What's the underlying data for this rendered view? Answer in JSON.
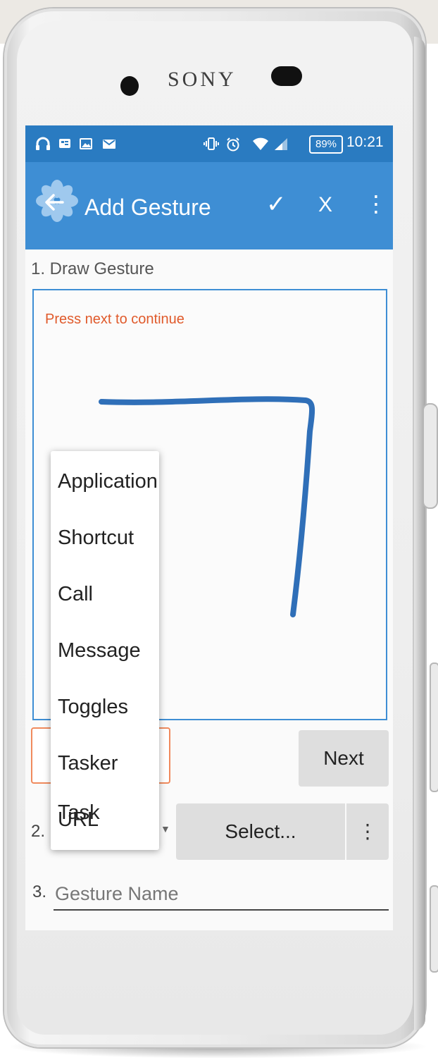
{
  "device": {
    "brand": "SONY"
  },
  "status_bar": {
    "battery": "89%",
    "time": "10:21",
    "icons": [
      "headphones-icon",
      "notification-icon",
      "image-icon",
      "mail-icon",
      "vibrate-icon",
      "alarm-icon",
      "wifi-icon",
      "signal-icon"
    ]
  },
  "app_bar": {
    "title": "Add Gesture",
    "actions": {
      "confirm": "✓",
      "cancel": "X",
      "more": "⋮"
    }
  },
  "steps": {
    "draw_label": "1. Draw Gesture",
    "hint": "Press next to continue",
    "next_label": "Next",
    "action_number": "2.",
    "select_label": "Select...",
    "name_number": "3.",
    "name_placeholder": "Gesture Name"
  },
  "action_menu": {
    "items": [
      "Application",
      "Shortcut",
      "Call",
      "Message",
      "Toggles",
      "Tasker Task",
      "URL"
    ]
  },
  "colors": {
    "status_bar": "#2a7bc1",
    "app_bar": "#3e8ed4",
    "gesture_stroke": "#2f6fb8",
    "hint": "#e05a2b"
  }
}
